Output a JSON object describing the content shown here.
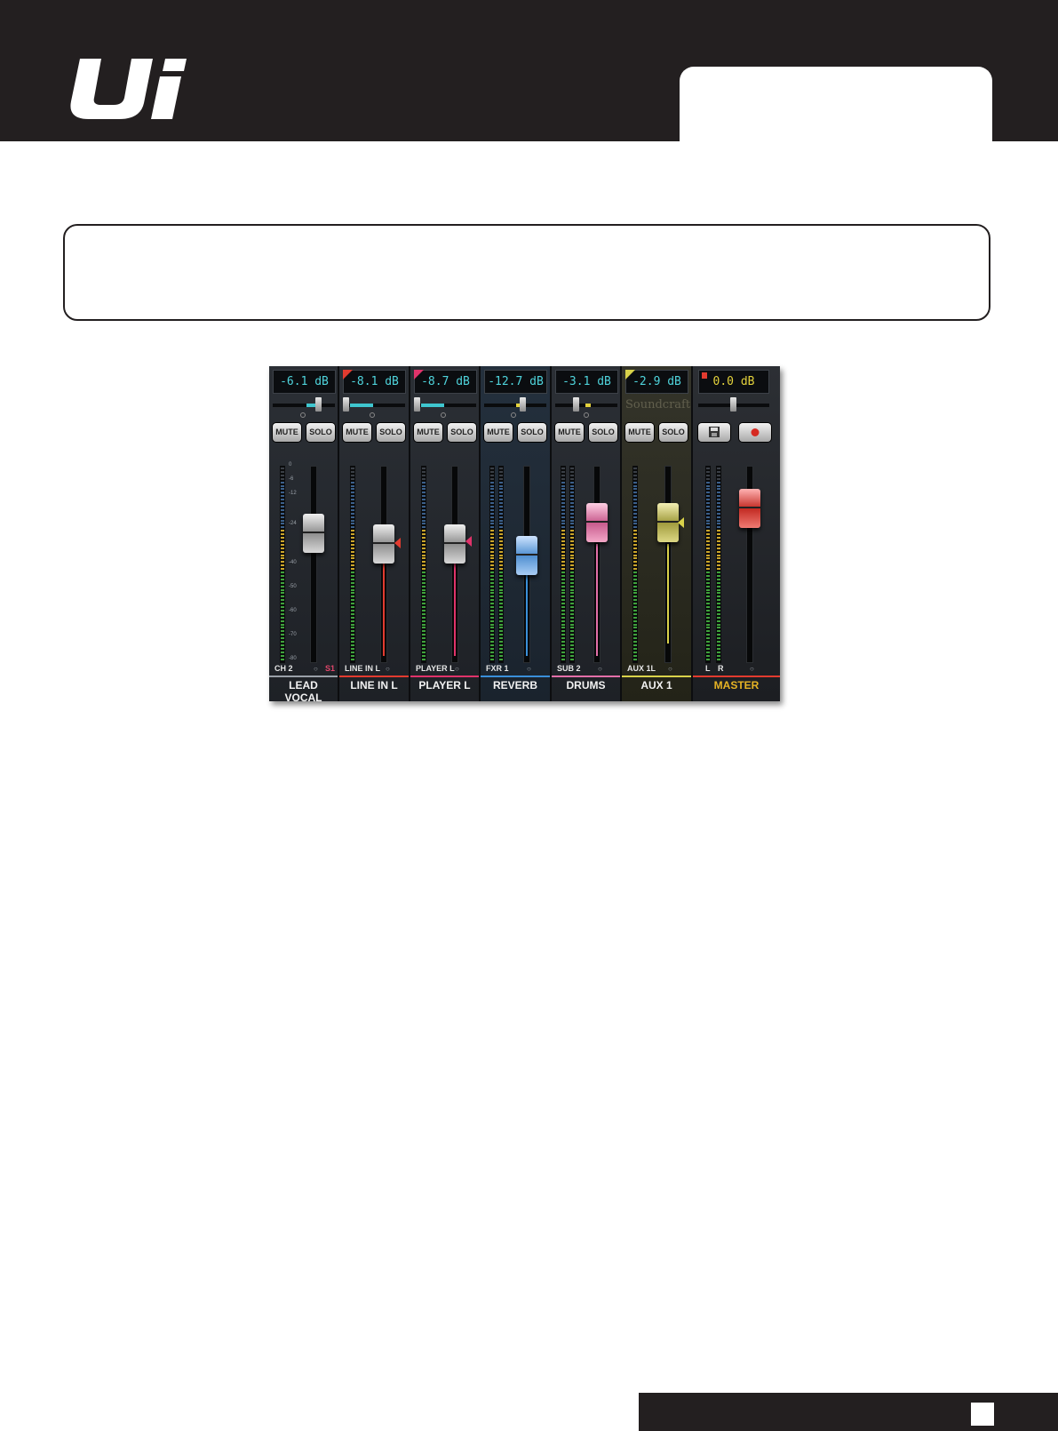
{
  "header": {
    "logo_text": "Ui"
  },
  "mixer": {
    "strips": [
      {
        "gain": "-6.1 dB",
        "mute": "MUTE",
        "solo": "SOLO",
        "channel_id": "CH 2",
        "safe": "S1",
        "name": "LEAD VOCAL",
        "color": "#9aa0a8",
        "fader_level_db": -24
      },
      {
        "gain": "-8.1 dB",
        "mute": "MUTE",
        "solo": "SOLO",
        "channel_id": "LINE IN L",
        "safe": "",
        "name": "LINE IN L",
        "color": "#e23b2f",
        "fader_level_db": -30
      },
      {
        "gain": "-8.7 dB",
        "mute": "MUTE",
        "solo": "SOLO",
        "channel_id": "PLAYER L",
        "safe": "",
        "name": "PLAYER L",
        "color": "#e0336a",
        "fader_level_db": -30
      },
      {
        "gain": "-12.7 dB",
        "mute": "MUTE",
        "solo": "SOLO",
        "channel_id": "FXR 1",
        "safe": "",
        "name": "REVERB",
        "color": "#3a8fd9",
        "fader_level_db": -40
      },
      {
        "gain": "-3.1 dB",
        "mute": "MUTE",
        "solo": "SOLO",
        "channel_id": "SUB 2",
        "safe": "",
        "name": "DRUMS",
        "color": "#e36fa8",
        "fader_level_db": -24
      },
      {
        "gain": "-2.9 dB",
        "mute": "MUTE",
        "solo": "SOLO",
        "channel_id": "AUX 1L",
        "safe": "",
        "name": "AUX 1",
        "color": "#d9d24a",
        "fader_level_db": -24,
        "brand": "Soundcraft"
      },
      {
        "gain": "0.0 dB",
        "channel_id_l": "L",
        "channel_id_r": "R",
        "name": "MASTER",
        "color": "#e23b2f",
        "fader_level_db": -12
      }
    ],
    "scale": [
      "0",
      "-6",
      "-12",
      "-24",
      "-40",
      "-50",
      "-60",
      "-70",
      "-80"
    ]
  },
  "colors": {
    "header_bg": "#231f20",
    "master_name": "#e6b324",
    "gain_text": "#4fd4dc"
  }
}
